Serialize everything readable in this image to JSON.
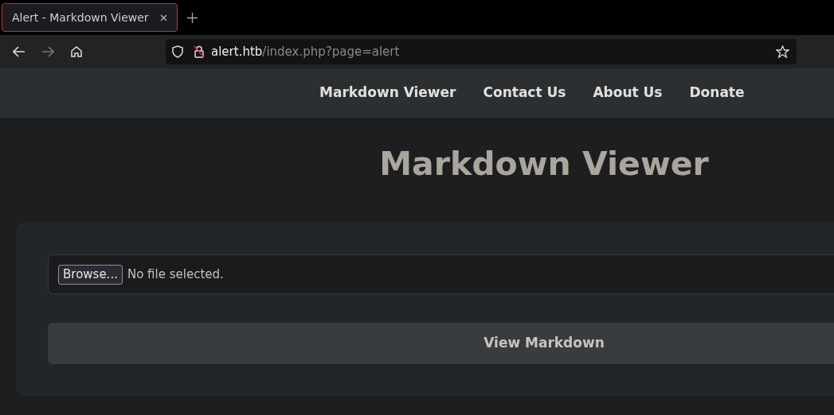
{
  "browser": {
    "tab": {
      "title": "Alert - Markdown Viewer",
      "selected": true
    },
    "url": {
      "host": "alert.htb",
      "path": "/index.php?page=alert"
    }
  },
  "nav": [
    "Markdown Viewer",
    "Contact Us",
    "About Us",
    "Donate"
  ],
  "heading": "Markdown Viewer",
  "form": {
    "browse_button": "Browse...",
    "file_status": "No file selected.",
    "submit": "View Markdown"
  }
}
